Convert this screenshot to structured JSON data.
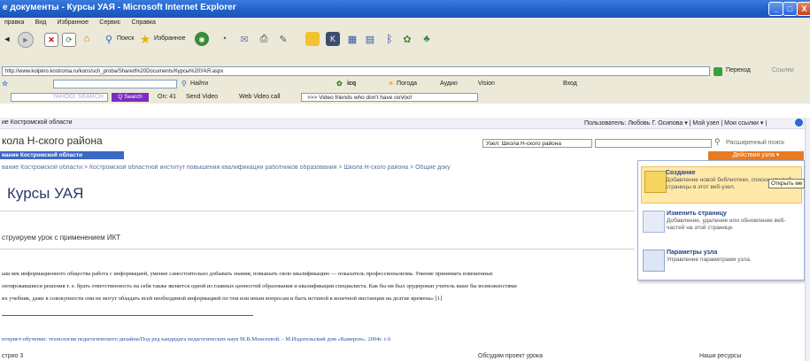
{
  "window": {
    "title": "е документы - Курсы УАЯ - Microsoft Internet Explorer",
    "controls": [
      "_",
      "□",
      "X"
    ]
  },
  "menubar": [
    "правка",
    "Вид",
    "Избранное",
    "Сервис",
    "Справка"
  ],
  "toolbar": {
    "search_label": "Поиск",
    "favorites_label": "Избранное"
  },
  "address": {
    "url": "http://www.koipkro.kostroma.ru/kons/sch_proba/Shared%20Documents/Курсы%20УАЯ.aspx",
    "go_label": "Переход",
    "links_label": "Ссылки"
  },
  "row2": {
    "find_label": "Найти",
    "icq_label": "icq",
    "weather_label": "Погода",
    "avatar_label": "Аудио",
    "vision_label": "Vision",
    "enter_label": "Вход"
  },
  "row3": {
    "yahoo_search": "YAHOO! SEARCH",
    "search_btn": "Q Search",
    "on_label": "On: 41",
    "send_video": "Send Video",
    "web_video": "Web Video call",
    "video_friends": ">>> Video friends who don't have ooVoo!"
  },
  "page": {
    "region": "ие Костромской области",
    "user_bar": "Пользователь: Любовь Г. Осипова ▾ | Мой узел | Мои ссылки ▾ |",
    "site_title": "кола Н-ского района",
    "site_subtitle": "вание Костромской области",
    "search_scope": "Узел: Школа Н-ского района",
    "advanced_search": "Расширенный поиск",
    "actions_button": "Действия узла ▾",
    "breadcrumb": "вание Костромской области > Костромской областной институт повышения квалификации работников образования > Школа Н-ского района > Общие доку",
    "page_heading": "Курсы УАЯ",
    "subheading": "струируем урок с применением ИКТ",
    "body_line1": "ыш век информационного общества работа с информацией, умение самостоятельно добывать знания, повышать свою квалификацию — показатель профессионализма. Умение принимать взвешенные",
    "body_line2": "онтировавшиеся решения т. е. брать ответственность на себя также является одной из главных ценностей образования и квалификации специалиста. Как бы ни был эрудирован учитель ваше бы возможностями",
    "body_line3": "их учебник, даже в совокупности они не могут обладать всей необходимой информацией по тем или иным вопросам и быть истиной в конечной инстанции на долгие времена» [1]",
    "footnote": "нтернет-обучение: технология педагогического дизайна/Под ред кандидата педагогических наук М.В.Моисеевой. - М.Издательский дом «Камерон». 2004г. с.6",
    "bottom_left": "стрио 3",
    "bottom_mid": "Обсудим проект урока",
    "bottom_right": "Наши ресурсы"
  },
  "menu": {
    "items": [
      {
        "title": "Создание",
        "desc": "Добавление новой библиотеки, списка или веб-страницы в этот веб-узел."
      },
      {
        "title": "Изменить страницу",
        "desc": "Добавление, удаление или обновление веб-частей на этой странице."
      },
      {
        "title": "Параметры узла",
        "desc": "Управление параметрами узла."
      }
    ],
    "tooltip": "Открыть ме"
  },
  "colors": {
    "title_bar": "#2460d0",
    "chrome": "#ece9d8",
    "accent_orange": "#e87a20",
    "link_blue": "#2a4fa8"
  }
}
